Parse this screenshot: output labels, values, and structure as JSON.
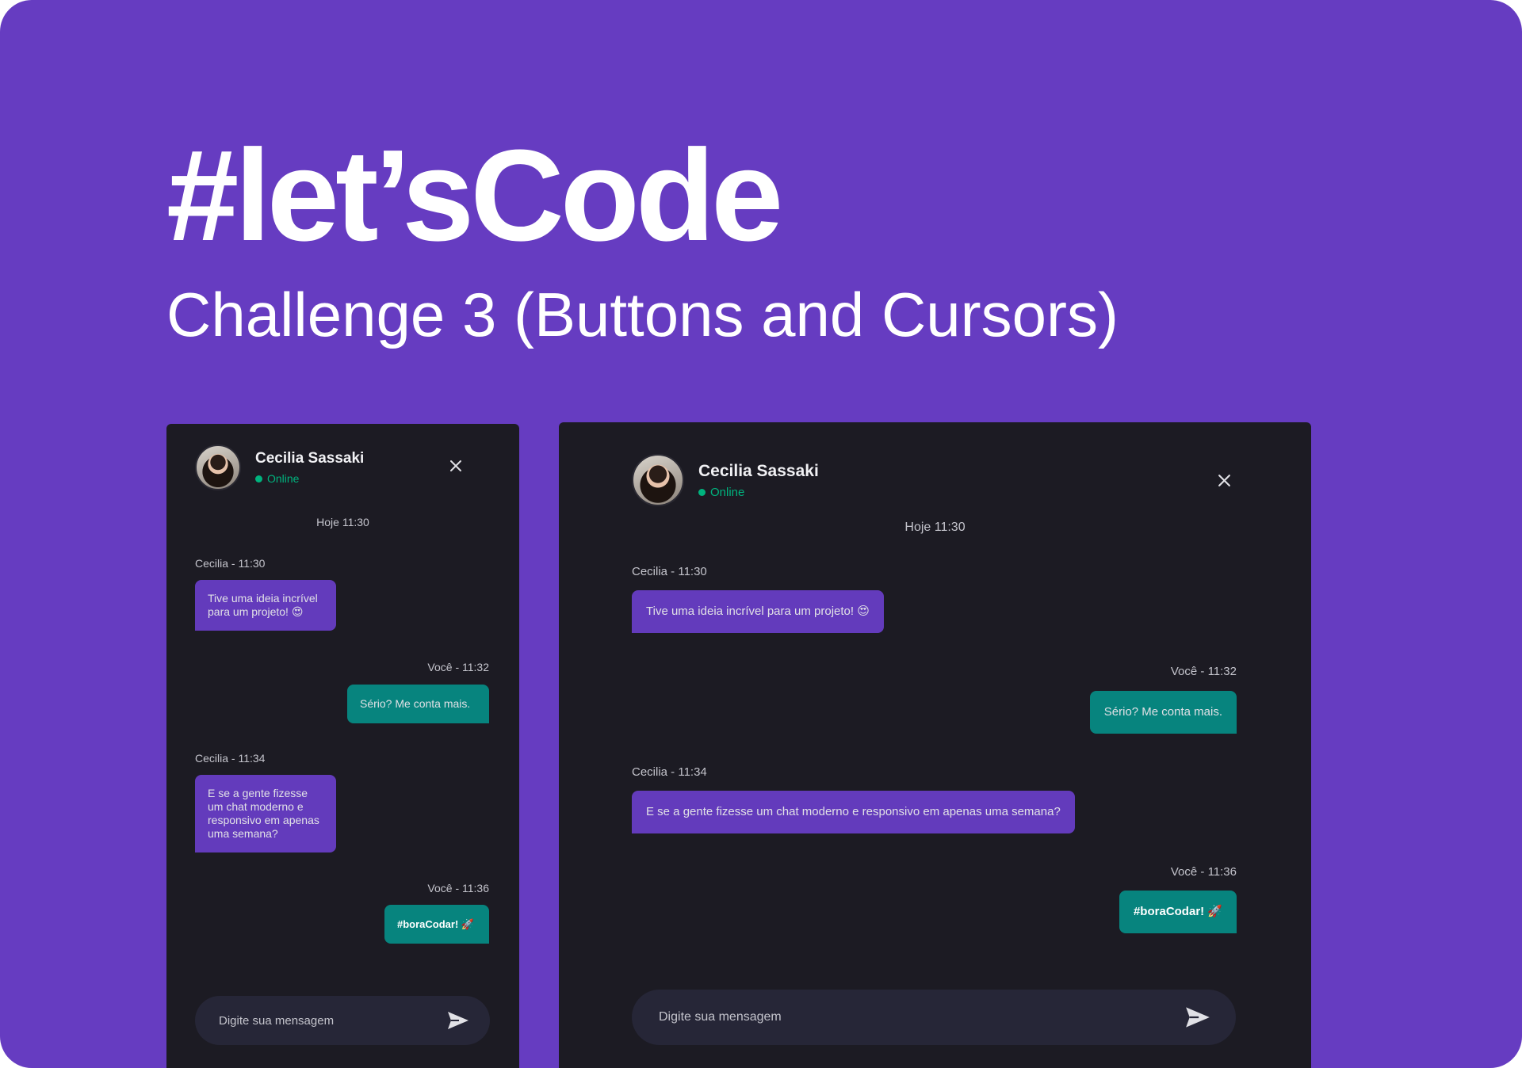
{
  "hero": {
    "title": "#let’sCode",
    "subtitle": "Challenge 3 (Buttons and Cursors)"
  },
  "colors": {
    "background": "#663cc1",
    "panel": "#1c1b23",
    "bubble_them": "#633bbc",
    "bubble_me": "#07847e",
    "online": "#00b37e",
    "composer": "#262637"
  },
  "chat": {
    "contact_name": "Cecilia Sassaki",
    "status": "Online",
    "day_label": "Hoje 11:30",
    "messages": [
      {
        "author": "them",
        "meta": "Cecilia - 11:30",
        "text": "Tive uma ideia incrível para um projeto! 😍"
      },
      {
        "author": "me",
        "meta": "Você - 11:32",
        "text": "Sério? Me conta mais."
      },
      {
        "author": "them",
        "meta": "Cecilia - 11:34",
        "text": "E se a gente fizesse um chat moderno e responsivo em apenas uma semana?"
      },
      {
        "author": "me",
        "meta": "Você - 11:36",
        "text": "#boraCodar! 🚀"
      }
    ],
    "input_placeholder": "Digite sua mensagem",
    "icons": {
      "close": "close-icon",
      "send": "send-icon",
      "status": "online-dot"
    }
  }
}
